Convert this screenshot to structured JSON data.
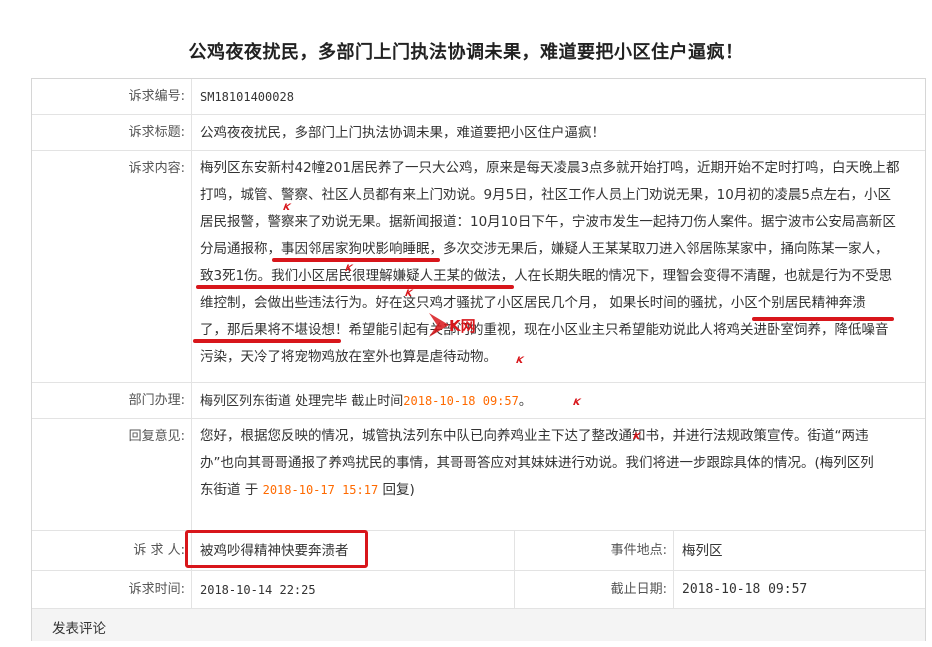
{
  "title": "公鸡夜夜扰民，多部门上门执法协调未果，难道要把小区住户逼疯！",
  "fields": {
    "id_label": "诉求编号:",
    "id_value": "SM18101400028",
    "subject_label": "诉求标题:",
    "subject_value": "公鸡夜夜扰民，多部门上门执法协调未果，难道要把小区住户逼疯！",
    "content_label": "诉求内容:",
    "content_lines": [
      "梅列区东安新村42幢201居民养了一只大公鸡，原来是每天凌晨3点多就开始打鸣，近期开始不定时打鸣，白天晚上都",
      "打鸣，城管、警察、社区人员都有来上门劝说。9月5日，社区工作人员上门劝说无果，10月初的凌晨5点左右，小区",
      "居民报警，警察来了劝说无果。据新闻报道：10月10日下午，宁波市发生一起持刀伤人案件。据宁波市公安局高新区",
      "分局通报称，事因邻居家狗吠影响睡眠，多次交涉无果后，嫌疑人王某某取刀进入邻居陈某家中，捅向陈某一家人，",
      "致3死1伤。我们小区居民很理解嫌疑人王某的做法，人在长期失眠的情况下，理智会变得不清醒，也就是行为不受思",
      "维控制，会做出些违法行为。好在这只鸡才骚扰了小区居民几个月，  如果长时间的骚扰，小区个别居民精神奔溃",
      "了，那后果将不堪设想！希望能引起有关部门的重视，现在小区业主只希望能劝说此人将鸡关进卧室饲养，降低噪音",
      "污染，天冷了将宠物鸡放在室外也算是虐待动物。"
    ],
    "dept_label": "部门办理:",
    "dept_value": "梅列区列东街道 处理完毕 截止时间",
    "dept_time": "2018-10-18 09:57",
    "dept_suffix": "。",
    "reply_label": "回复意见:",
    "reply_lines": [
      "您好，根据您反映的情况，城管执法列东中队已向养鸡业主下达了整改通知书，并进行法规政策宣传。街道“两违",
      "办”也向其哥哥通报了养鸡扰民的事情，其哥哥答应对其妹妹进行劝说。我们将进一步跟踪具体的情况。(梅列区列"
    ],
    "reply_tail_prefix": "东街道 于 ",
    "reply_tail_time": "2018-10-17 15:17",
    "reply_tail_suffix": " 回复)",
    "petitioner_label": "诉 求 人:",
    "petitioner_value": "被鸡吵得精神快要奔溃者",
    "location_label": "事件地点:",
    "location_value": "梅列区",
    "time_label": "诉求时间:",
    "time_value": "2018-10-14 22:25",
    "deadline_label": "截止日期:",
    "deadline_value": "2018-10-18 09:57"
  },
  "footer": {
    "comment_label": "发表评论"
  },
  "watermark": {
    "logo_text": "K网",
    "mark": "K"
  },
  "colors": {
    "accent_red": "#d8161b",
    "time_orange": "#ff6a00"
  }
}
